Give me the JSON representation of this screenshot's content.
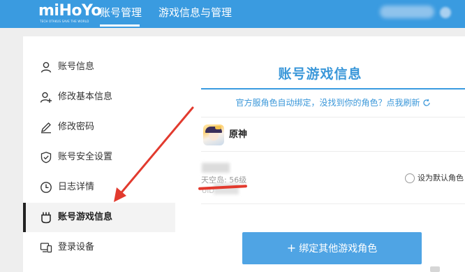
{
  "header": {
    "logo_text": "miHoYo",
    "logo_tagline": "TECH OTAKUS SAVE THE WORLD",
    "nav": [
      {
        "label": "账号管理",
        "active": true
      },
      {
        "label": "游戏信息与管理",
        "active": false
      }
    ],
    "accent_color": "#3a9be0"
  },
  "sidebar": {
    "items": [
      {
        "label": "账号信息",
        "icon": "user-icon",
        "active": false
      },
      {
        "label": "修改基本信息",
        "icon": "user-plus-icon",
        "active": false
      },
      {
        "label": "修改密码",
        "icon": "pencil-icon",
        "active": false
      },
      {
        "label": "账号安全设置",
        "icon": "shield-check-icon",
        "active": false
      },
      {
        "label": "日志详情",
        "icon": "clock-icon",
        "active": false
      },
      {
        "label": "账号游戏信息",
        "icon": "game-controller-icon",
        "active": true
      },
      {
        "label": "登录设备",
        "icon": "device-icon",
        "active": false
      }
    ]
  },
  "main": {
    "title": "账号游戏信息",
    "hint": "官方服角色自动绑定，没找到你的角色？点我刷新",
    "game": {
      "name": "原神",
      "server_text": "天空岛: 56级",
      "uid_label": "UID",
      "default_role_label": "设为默认角色"
    },
    "bind_button_label": "绑定其他游戏角色",
    "bind_button_plus": "+"
  },
  "annotation": {
    "arrow_color": "#e23a2e"
  }
}
